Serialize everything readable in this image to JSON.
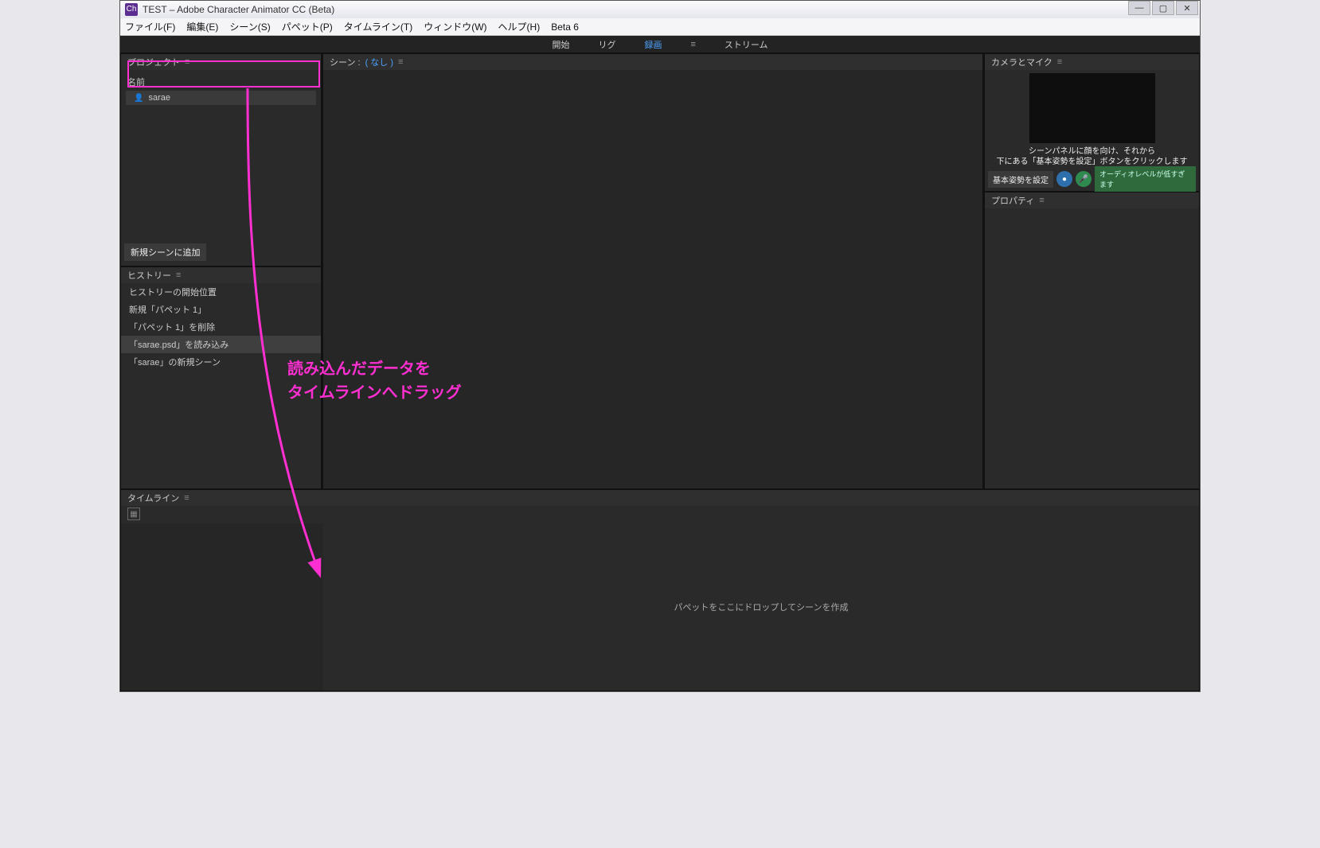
{
  "title": "TEST – Adobe Character Animator CC (Beta)",
  "menu": {
    "file": "ファイル(F)",
    "edit": "編集(E)",
    "scene": "シーン(S)",
    "puppet": "パペット(P)",
    "timeline": "タイムライン(T)",
    "window": "ウィンドウ(W)",
    "help": "ヘルプ(H)",
    "beta": "Beta 6"
  },
  "workspace": {
    "start": "開始",
    "rig": "リグ",
    "record": "録画",
    "stream": "ストリーム"
  },
  "project": {
    "title": "プロジェクト",
    "column_name": "名前",
    "item": "sarae",
    "add_scene": "新規シーンに追加"
  },
  "history": {
    "title": "ヒストリー",
    "items": [
      "ヒストリーの開始位置",
      "新規「パペット 1」",
      "「パペット 1」を削除",
      "「sarae.psd」を読み込み",
      "「sarae」の新規シーン"
    ],
    "selected_index": 3
  },
  "scene": {
    "label": "シーン :",
    "none": "( なし )"
  },
  "timeline": {
    "title": "タイムライン",
    "drop_hint": "パペットをここにドロップしてシーンを作成"
  },
  "camera": {
    "title": "カメラとマイク",
    "hint_line1": "シーンパネルに顔を向け、それから",
    "hint_line2": "下にある「基本姿勢を設定」ボタンをクリックします",
    "set_pose": "基本姿勢を設定",
    "audio_level": "オーディオレベルが低すぎます"
  },
  "properties": {
    "title": "プロパティ"
  },
  "annotation": {
    "line1": "読み込んだデータを",
    "line2": "タイムラインへドラッグ"
  }
}
